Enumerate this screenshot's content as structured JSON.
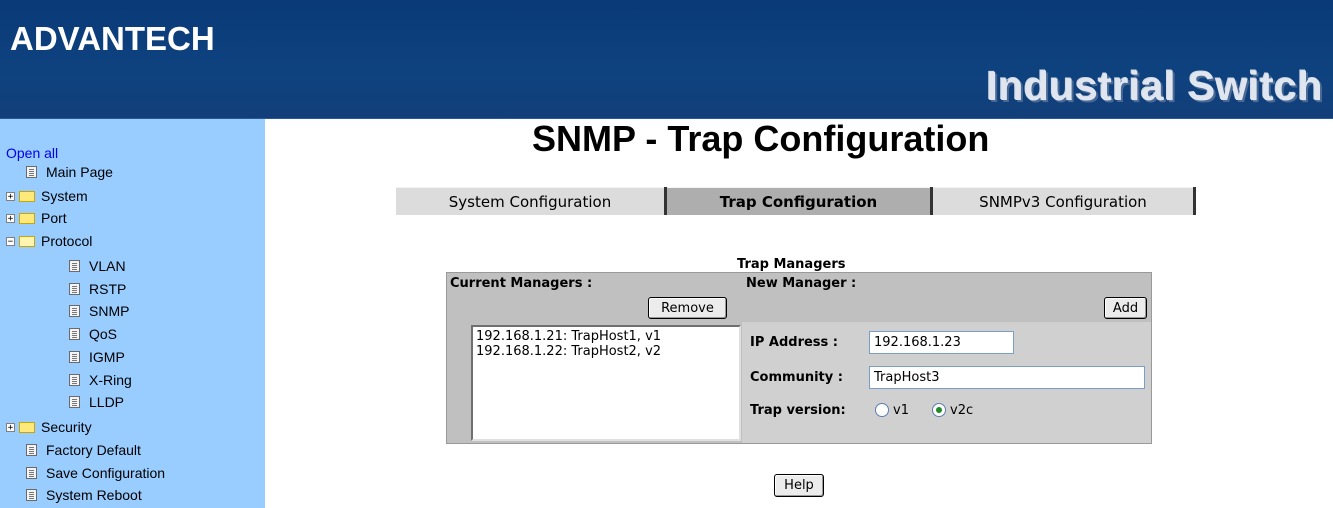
{
  "header": {
    "logo": "ADVANTECH",
    "product": "Industrial Switch"
  },
  "sidebar": {
    "open_all": "Open all",
    "items": [
      {
        "label": "Main Page",
        "type": "doc"
      },
      {
        "label": "System",
        "type": "folder",
        "expander": "+"
      },
      {
        "label": "Port",
        "type": "folder",
        "expander": "+"
      },
      {
        "label": "Protocol",
        "type": "folder-open",
        "expander": "−"
      },
      {
        "label": "VLAN",
        "type": "doc"
      },
      {
        "label": "RSTP",
        "type": "doc"
      },
      {
        "label": "SNMP",
        "type": "doc"
      },
      {
        "label": "QoS",
        "type": "doc"
      },
      {
        "label": "IGMP",
        "type": "doc"
      },
      {
        "label": "X-Ring",
        "type": "doc"
      },
      {
        "label": "LLDP",
        "type": "doc"
      },
      {
        "label": "Security",
        "type": "folder",
        "expander": "+"
      },
      {
        "label": "Factory Default",
        "type": "doc"
      },
      {
        "label": "Save Configuration",
        "type": "doc"
      },
      {
        "label": "System Reboot",
        "type": "doc"
      }
    ]
  },
  "main": {
    "title": "SNMP - Trap Configuration",
    "tabs": [
      {
        "label": "System Configuration",
        "active": false
      },
      {
        "label": "Trap Configuration",
        "active": true
      },
      {
        "label": "SNMPv3 Configuration",
        "active": false
      }
    ],
    "section_title": "Trap Managers",
    "current_managers_label": "Current Managers :",
    "remove_button": "Remove",
    "new_manager_label": "New Manager :",
    "add_button": "Add",
    "managers": [
      "192.168.1.21: TrapHost1, v1",
      "192.168.1.22: TrapHost2, v2"
    ],
    "ip_address_label": "IP Address :",
    "ip_address_value": "192.168.1.23",
    "community_label": "Community :",
    "community_value": "TrapHost3",
    "trap_version_label": "Trap version:",
    "trap_version_options": [
      "v1",
      "v2c"
    ],
    "trap_version_selected": "v2c",
    "help_button": "Help"
  },
  "colors": {
    "header_bg": "#0e427f",
    "sidebar_bg": "#99ccff",
    "panel_bg": "#c0c0c0",
    "link": "#0000ee"
  }
}
